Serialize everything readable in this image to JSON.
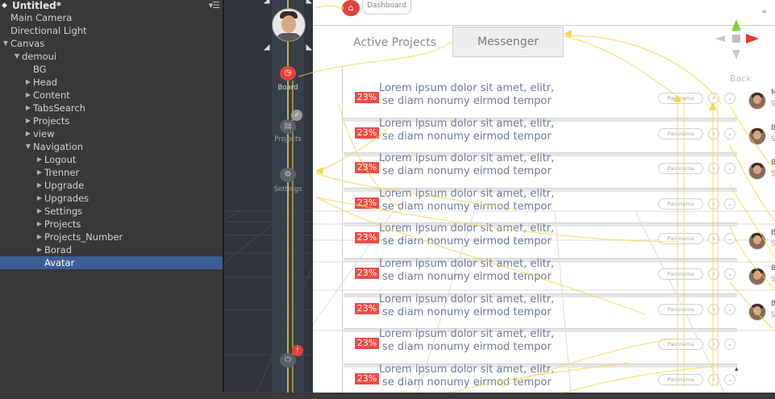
{
  "hierarchy": {
    "scene_title": "Untitled*",
    "menu_icon": "hamburger-menu-icon",
    "items": [
      {
        "label": "Main Camera",
        "depth": 0,
        "expander": "none"
      },
      {
        "label": "Directional Light",
        "depth": 0,
        "expander": "none"
      },
      {
        "label": "Canvas",
        "depth": 0,
        "expander": "expanded"
      },
      {
        "label": "demoui",
        "depth": 1,
        "expander": "expanded"
      },
      {
        "label": "BG",
        "depth": 2,
        "expander": "none"
      },
      {
        "label": "Head",
        "depth": 2,
        "expander": "collapsed"
      },
      {
        "label": "Content",
        "depth": 2,
        "expander": "collapsed"
      },
      {
        "label": "TabsSearch",
        "depth": 2,
        "expander": "collapsed"
      },
      {
        "label": "Projects",
        "depth": 2,
        "expander": "collapsed"
      },
      {
        "label": "view",
        "depth": 2,
        "expander": "collapsed"
      },
      {
        "label": "Navigation",
        "depth": 2,
        "expander": "expanded"
      },
      {
        "label": "Logout",
        "depth": 3,
        "expander": "collapsed"
      },
      {
        "label": "Trenner",
        "depth": 3,
        "expander": "collapsed"
      },
      {
        "label": "Upgrade",
        "depth": 3,
        "expander": "collapsed"
      },
      {
        "label": "Upgrades",
        "depth": 3,
        "expander": "collapsed"
      },
      {
        "label": "Settings",
        "depth": 3,
        "expander": "collapsed"
      },
      {
        "label": "Projects",
        "depth": 3,
        "expander": "collapsed"
      },
      {
        "label": "Projects_Number",
        "depth": 3,
        "expander": "collapsed"
      },
      {
        "label": "Borad",
        "depth": 3,
        "expander": "collapsed"
      },
      {
        "label": "Avatar",
        "depth": 3,
        "expander": "none",
        "selected": true
      }
    ]
  },
  "scene": {
    "dashboard_label": "Dashboard",
    "tabs": {
      "active_projects": "Active Projects",
      "messenger": "Messenger"
    },
    "back_label": "Back",
    "nav": {
      "board_label": "Board",
      "projects_label": "Projects",
      "settings_label": "Settings"
    },
    "rows": [
      {
        "badge": "23%",
        "line1": "Lorem ipsum dolor sit amet, elitr,",
        "line2": "se diam nonumy eirmod tempor",
        "pill": "Panorama",
        "name": "M",
        "sub": "Se"
      },
      {
        "badge": "23%",
        "line1": "Lorem ipsum dolor sit amet, elitr,",
        "line2": "se diam nonumy eirmod tempor",
        "pill": "Panorama",
        "name": "B",
        "sub": "Se"
      },
      {
        "badge": "23%",
        "line1": "Lorem ipsum dolor sit amet, elitr,",
        "line2": "se diam nonumy eirmod tempor",
        "pill": "Panorama",
        "name": "B",
        "sub": "Se"
      },
      {
        "badge": "23%",
        "line1": "Lorem ipsum dolor sit amet, elitr,",
        "line2": "se diam nonumy eirmod tempor",
        "pill": "Panorama",
        "name": "",
        "sub": ""
      },
      {
        "badge": "23%",
        "line1": "Lorem ipsum dolor sit amet, elitr,",
        "line2": "se diam nonumy eirmod tempor",
        "pill": "Panorama",
        "name": "B",
        "sub": "Se"
      },
      {
        "badge": "23%",
        "line1": "Lorem ipsum dolor sit amet, elitr,",
        "line2": "se diam nonumy eirmod tempor",
        "pill": "Panorama",
        "name": "B",
        "sub": "Se"
      },
      {
        "badge": "23%",
        "line1": "Lorem ipsum dolor sit amet, elitr,",
        "line2": "se diam nonumy eirmod tempor",
        "pill": "Panorama",
        "name": "B",
        "sub": "Se"
      },
      {
        "badge": "23%",
        "line1": "Lorem ipsum dolor sit amet, elitr,",
        "line2": "se diam nonumy eirmod tempor",
        "pill": "Panorama",
        "name": "",
        "sub": ""
      },
      {
        "badge": "23%",
        "line1": "Lorem ipsum dolor sit amet, elitr,",
        "line2": "se diam nonumy eirmod tempor",
        "pill": "Panorama",
        "name": "",
        "sub": ""
      }
    ],
    "colors": {
      "badge_red": "#ed4c46",
      "gizmo_yellow": "#f5d64a",
      "gizmo_green": "#7ed23a",
      "gizmo_red": "#e03b2f",
      "selection_blue": "#3e5f96"
    }
  }
}
